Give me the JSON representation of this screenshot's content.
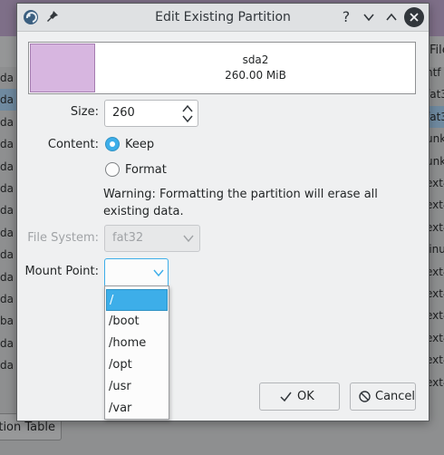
{
  "dialog": {
    "title": "Edit Existing Partition",
    "titlebar_icons": [
      "app-icon",
      "pin-icon"
    ],
    "titlebar_buttons": {
      "help": "?",
      "minimize": "∨",
      "maximize": "∧",
      "close": "✕"
    }
  },
  "partition": {
    "name": "sda2",
    "size": "260.00 MiB",
    "color": "#d7b6e0"
  },
  "form": {
    "size_label": "Size:",
    "size_value": "260",
    "content_label": "Content:",
    "keep_label": "Keep",
    "keep_selected": true,
    "format_label": "Format",
    "format_selected": false,
    "warning": "Warning: Formatting the partition will erase all existing data.",
    "filesystem_label": "File System:",
    "filesystem_value": "fat32",
    "mountpoint_label": "Mount Point:",
    "mountpoint_value": ""
  },
  "mount_options": [
    "/",
    "/boot",
    "/home",
    "/opt",
    "/usr",
    "/var"
  ],
  "mount_selected_index": 0,
  "buttons": {
    "ok": "OK",
    "cancel": "Cancel"
  },
  "background": {
    "top_right_label": "File",
    "left_rows": [
      "da",
      "da",
      "da",
      "da",
      "da",
      "da",
      "da",
      "da",
      "da",
      "da",
      "da",
      "ba",
      "da",
      "da"
    ],
    "right_rows": [
      "ntf",
      "fat3",
      "fat3",
      "unk",
      "unk",
      "ext4",
      "ext4",
      "ext4",
      "linu",
      "ext4",
      "ext4",
      "ext4",
      "ext4",
      "ext4",
      "ext4"
    ],
    "bottom_button": "ition Table"
  },
  "colors": {
    "accent": "#3daee9",
    "window_bg": "#eff0f1"
  }
}
